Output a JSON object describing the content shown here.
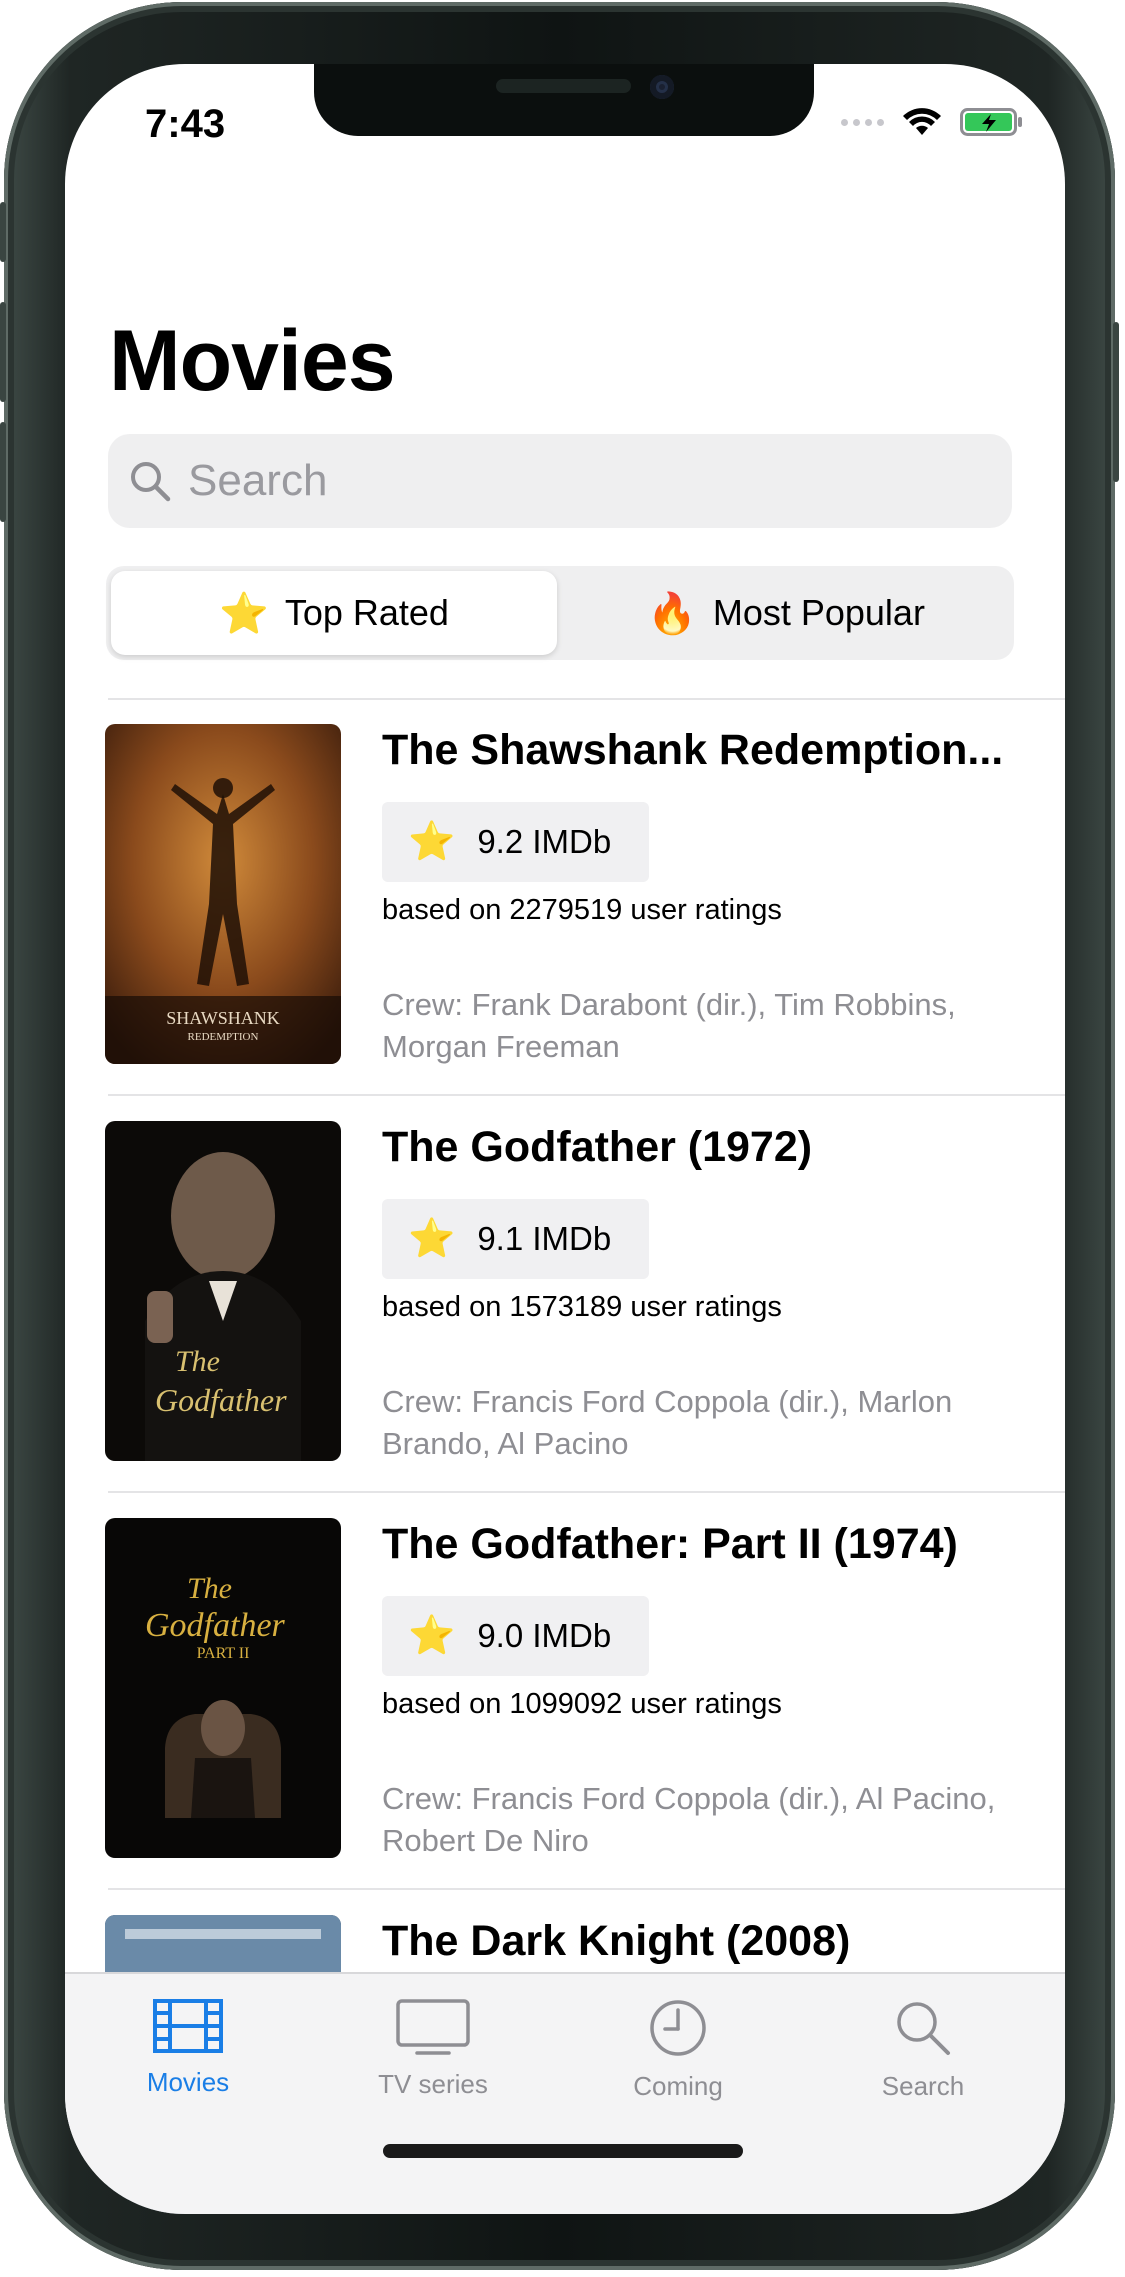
{
  "status_bar": {
    "time": "7:43"
  },
  "header": {
    "title": "Movies"
  },
  "search": {
    "placeholder": "Search"
  },
  "segments": [
    {
      "emoji": "⭐",
      "label": "Top Rated",
      "selected": true
    },
    {
      "emoji": "🔥",
      "label": "Most Popular",
      "selected": false
    }
  ],
  "movies": [
    {
      "title": "The Shawshank Redemption...",
      "rating": "9.2 IMDb",
      "ratings_count": "based on 2279519 user ratings",
      "crew": "Crew: Frank Darabont (dir.), Tim Robbins, Morgan Freeman",
      "poster_text": [
        "SHAWSHANK",
        "REDEMPTION"
      ]
    },
    {
      "title": "The Godfather (1972)",
      "rating": "9.1 IMDb",
      "ratings_count": "based on 1573189 user ratings",
      "crew": "Crew: Francis Ford Coppola (dir.), Marlon Brando, Al Pacino",
      "poster_text": [
        "The",
        "Godfather"
      ]
    },
    {
      "title": "The Godfather: Part II (1974)",
      "rating": "9.0 IMDb",
      "ratings_count": "based on 1099092 user ratings",
      "crew": "Crew: Francis Ford Coppola (dir.), Al Pacino, Robert De Niro",
      "poster_text": [
        "The",
        "Godfather",
        "PART II"
      ]
    },
    {
      "title": "The Dark Knight (2008)"
    }
  ],
  "tab_bar": {
    "items": [
      {
        "label": "Movies",
        "icon": "film-icon",
        "active": true
      },
      {
        "label": "TV series",
        "icon": "tv-icon",
        "active": false
      },
      {
        "label": "Coming",
        "icon": "clock-icon",
        "active": false
      },
      {
        "label": "Search",
        "icon": "magnifier-icon",
        "active": false
      }
    ]
  },
  "colors": {
    "accent": "#1a7ee6",
    "secondary_text": "#8e8e93",
    "chip_background": "#f0f0f2"
  }
}
